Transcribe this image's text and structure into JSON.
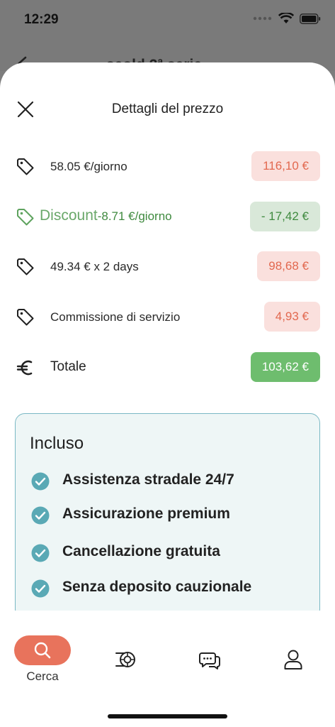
{
  "status": {
    "time": "12:29"
  },
  "behind": {
    "title": "seold 2ª serie"
  },
  "sheet": {
    "title": "Dettagli del prezzo"
  },
  "rows": [
    {
      "label": "58.05 €/giorno",
      "amount": "116,10 €"
    },
    {
      "discount_word": "Discount",
      "discount_amount": "-8.71 €/giorno",
      "amount": "- 17,42 €"
    },
    {
      "label": "49.34 € x 2 days",
      "amount": "98,68 €"
    },
    {
      "label": "Commissione di servizio",
      "amount": "4,93 €"
    },
    {
      "label": "Totale",
      "amount": "103,62 €"
    }
  ],
  "included": {
    "title": "Incluso",
    "items": [
      "Assistenza stradale 24/7",
      "Assicurazione premium",
      "Cancellazione gratuita",
      "Senza deposito cauzionale"
    ]
  },
  "nav": {
    "search_label": "Cerca",
    "items": [
      "search-icon",
      "tire-icon",
      "chat-icon",
      "profile-icon"
    ]
  },
  "colors": {
    "accent": "#e8735c",
    "price_red_bg": "#fae0dd",
    "price_red_text": "#e2684f",
    "discount_bg": "#d9e8d9",
    "discount_text": "#3f8a3f",
    "total_bg": "#6ebd6e",
    "check": "#5aa9b5",
    "included_bg": "#eef6f6"
  }
}
